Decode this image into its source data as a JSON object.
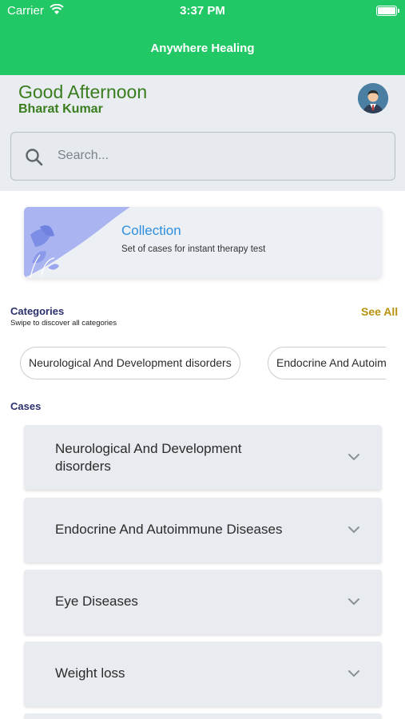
{
  "status_bar": {
    "carrier": "Carrier",
    "time": "3:37 PM"
  },
  "app": {
    "title": "Anywhere Healing",
    "accent": "#22c766"
  },
  "greeting": {
    "text": "Good Afternoon",
    "user": "Bharat Kumar"
  },
  "search": {
    "placeholder": "Search..."
  },
  "collection": {
    "title": "Collection",
    "subtitle": "Set of cases for instant therapy test"
  },
  "categories": {
    "title": "Categories",
    "subtitle": "Swipe to discover all categories",
    "see_all": "See All",
    "chips": [
      "Neurological And Development disorders",
      "Endocrine And Autoimmune Diseases"
    ]
  },
  "cases": {
    "title": "Cases",
    "items": [
      "Neurological And Development disorders",
      "Endocrine And Autoimmune Diseases",
      "Eye Diseases",
      "Weight loss"
    ]
  },
  "icons": {
    "wifi": "wifi-icon",
    "battery": "battery-icon",
    "avatar": "user-avatar",
    "search": "search-icon",
    "chevron": "chevron-down-icon"
  }
}
